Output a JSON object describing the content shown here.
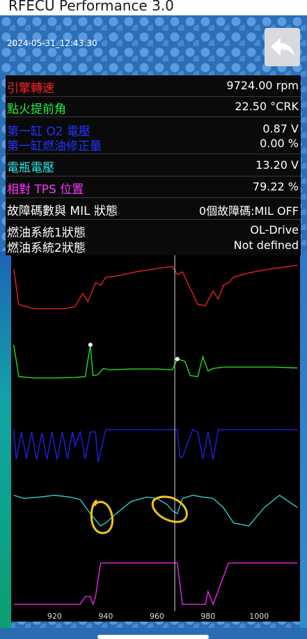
{
  "app": {
    "title": "RFECU Performance 3.0",
    "timestamp": "2024-05-31_12:43:30",
    "back_icon": "back-arrow-icon"
  },
  "readings": [
    {
      "label": "引擎轉速",
      "value": "9724.00 rpm",
      "color": "#ff2222"
    },
    {
      "label": "點火提前角",
      "value": "22.50 °CRK",
      "color": "#22ee44"
    },
    {
      "label": "第一缸 O2 電壓",
      "value": "0.87 V",
      "color": "#2233ff"
    },
    {
      "label": "第一缸燃油修正量",
      "value": "0.00 %",
      "color": "#2233ff"
    },
    {
      "label": "電瓶電壓",
      "value": "13.20 V",
      "color": "#33e6e6"
    },
    {
      "label": "相對 TPS 位置",
      "value": "79.22 %",
      "color": "#ff33ff"
    },
    {
      "label": "故障碼數與 MIL 狀態",
      "value": "0個故障碼:MIL OFF",
      "color": "#ffffff"
    },
    {
      "label": "燃油系統1狀態",
      "value": "OL-Drive",
      "color": "#ffffff"
    },
    {
      "label": "燃油系統2狀態",
      "value": "Not defined",
      "color": "#ffffff"
    }
  ],
  "chart_data": {
    "type": "line",
    "x_ticks": [
      "920",
      "940",
      "960",
      "980",
      "1000"
    ],
    "cursor_x": 967,
    "series": [
      {
        "color": "#e8221e",
        "x": [
          904,
          906,
          912,
          918,
          924,
          928,
          931,
          933,
          936,
          938,
          940,
          944,
          952,
          960,
          966,
          968,
          970,
          973,
          976,
          979,
          982,
          984,
          986,
          988,
          990,
          996,
          1004,
          1012,
          1015
        ],
        "y": [
          0.85,
          0.2,
          0.12,
          0.12,
          0.12,
          0.16,
          0.4,
          0.25,
          0.6,
          0.55,
          0.7,
          0.72,
          0.8,
          0.86,
          0.9,
          0.75,
          0.8,
          0.5,
          0.2,
          0.18,
          0.45,
          0.3,
          0.55,
          0.6,
          0.7,
          0.78,
          0.85,
          0.9,
          0.92
        ]
      },
      {
        "color": "#22dd22",
        "x": [
          904,
          906,
          912,
          920,
          928,
          932,
          934,
          935,
          937,
          939,
          942,
          950,
          960,
          966,
          968,
          971,
          973,
          976,
          978,
          980,
          982,
          986,
          996,
          1006,
          1015
        ],
        "y": [
          0.85,
          0.18,
          0.15,
          0.15,
          0.16,
          0.18,
          0.85,
          0.2,
          0.22,
          0.35,
          0.32,
          0.34,
          0.34,
          0.32,
          0.55,
          0.5,
          0.2,
          0.18,
          0.6,
          0.3,
          0.35,
          0.38,
          0.38,
          0.38,
          0.36
        ],
        "markers": [
          [
            934,
            0.85
          ],
          [
            968,
            0.55
          ]
        ]
      },
      {
        "color": "#2020ee",
        "x": [
          904,
          905,
          907,
          909,
          911,
          913,
          915,
          917,
          919,
          921,
          923,
          925,
          927,
          928,
          930,
          932,
          934,
          936,
          937,
          940,
          948,
          956,
          966,
          968,
          969,
          970,
          974,
          976,
          978,
          980,
          982,
          984,
          986,
          988,
          990,
          992,
          994,
          998,
          1006,
          1015
        ],
        "y": [
          0.85,
          0.2,
          0.8,
          0.22,
          0.8,
          0.2,
          0.78,
          0.2,
          0.8,
          0.2,
          0.8,
          0.22,
          0.8,
          0.5,
          0.8,
          0.22,
          0.8,
          0.8,
          0.15,
          0.85,
          0.85,
          0.85,
          0.85,
          0.85,
          0.25,
          0.25,
          0.85,
          0.8,
          0.22,
          0.8,
          0.2,
          0.85,
          0.85,
          0.85,
          0.85,
          0.85,
          0.85,
          0.85,
          0.85,
          0.85
        ]
      },
      {
        "color": "#33cccc",
        "x": [
          904,
          908,
          914,
          920,
          926,
          930,
          934,
          938,
          940,
          944,
          950,
          956,
          960,
          964,
          966,
          968,
          970,
          974,
          978,
          982,
          986,
          990,
          996,
          1002,
          1008,
          1015
        ],
        "y": [
          0.75,
          0.7,
          0.72,
          0.75,
          0.72,
          0.68,
          0.45,
          0.25,
          0.3,
          0.45,
          0.65,
          0.72,
          0.7,
          0.6,
          0.5,
          0.45,
          0.7,
          0.75,
          0.72,
          0.7,
          0.55,
          0.3,
          0.25,
          0.55,
          0.75,
          0.55
        ]
      },
      {
        "color": "#ee22ee",
        "x": [
          904,
          930,
          932,
          934,
          935,
          936,
          938,
          966,
          967,
          968,
          970,
          973,
          976,
          979,
          980,
          982,
          988,
          1015
        ],
        "y": [
          0.05,
          0.05,
          0.2,
          0.2,
          0.05,
          0.2,
          0.85,
          0.85,
          0.85,
          0.85,
          0.05,
          0.05,
          0.05,
          0.05,
          0.3,
          0.05,
          0.85,
          0.85
        ]
      }
    ],
    "annotation_color": "#f0c419"
  }
}
